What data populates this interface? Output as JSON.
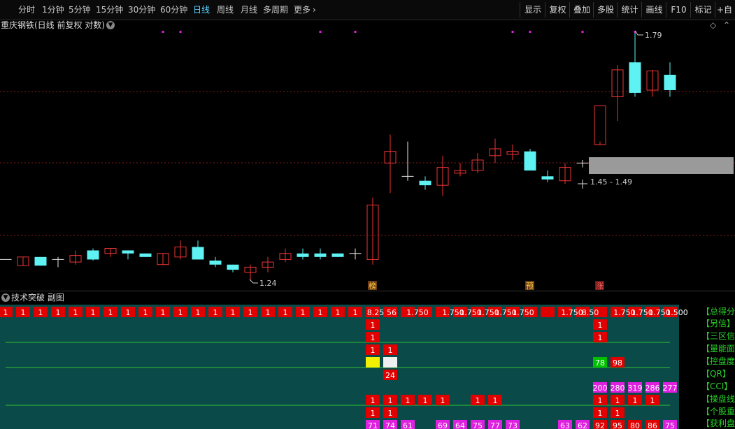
{
  "toolbar": {
    "periods": [
      "分时",
      "1分钟",
      "5分钟",
      "15分钟",
      "30分钟",
      "60分钟",
      "日线",
      "周线",
      "月线",
      "多周期",
      "更多"
    ],
    "active_period": "日线",
    "buttons": [
      "显示",
      "复权",
      "叠加",
      "多股",
      "统计",
      "画线",
      "F10",
      "标记",
      "+自选"
    ]
  },
  "chart": {
    "title": "重庆钢铁(日线 前复权 对数)",
    "annotation_high": "1.79",
    "annotation_low": "1.24",
    "annotation_range": "1.45 - 1.49",
    "markers": [
      "榜",
      "预",
      "涨"
    ],
    "scale": "log",
    "candles": [
      {
        "o": 1.25,
        "h": 1.25,
        "l": 1.25,
        "c": 1.25
      },
      {
        "o": 1.238,
        "h": 1.255,
        "l": 1.238,
        "c": 1.255
      },
      {
        "o": 1.255,
        "h": 1.255,
        "l": 1.238,
        "c": 1.238
      },
      {
        "o": 1.25,
        "h": 1.255,
        "l": 1.235,
        "c": 1.25
      },
      {
        "o": 1.245,
        "h": 1.268,
        "l": 1.24,
        "c": 1.258
      },
      {
        "o": 1.268,
        "h": 1.272,
        "l": 1.248,
        "c": 1.25
      },
      {
        "o": 1.262,
        "h": 1.272,
        "l": 1.255,
        "c": 1.272
      },
      {
        "o": 1.268,
        "h": 1.268,
        "l": 1.25,
        "c": 1.262
      },
      {
        "o": 1.262,
        "h": 1.262,
        "l": 1.255,
        "c": 1.255
      },
      {
        "o": 1.24,
        "h": 1.262,
        "l": 1.24,
        "c": 1.262
      },
      {
        "o": 1.255,
        "h": 1.288,
        "l": 1.25,
        "c": 1.275
      },
      {
        "o": 1.275,
        "h": 1.288,
        "l": 1.25,
        "c": 1.25
      },
      {
        "o": 1.248,
        "h": 1.255,
        "l": 1.235,
        "c": 1.24
      },
      {
        "o": 1.24,
        "h": 1.24,
        "l": 1.225,
        "c": 1.23
      },
      {
        "o": 1.225,
        "h": 1.24,
        "l": 1.21,
        "c": 1.235
      },
      {
        "o": 1.235,
        "h": 1.255,
        "l": 1.225,
        "c": 1.245
      },
      {
        "o": 1.25,
        "h": 1.272,
        "l": 1.245,
        "c": 1.262
      },
      {
        "o": 1.262,
        "h": 1.272,
        "l": 1.25,
        "c": 1.255
      },
      {
        "o": 1.262,
        "h": 1.272,
        "l": 1.25,
        "c": 1.255
      },
      {
        "o": 1.262,
        "h": 1.262,
        "l": 1.255,
        "c": 1.255
      },
      {
        "o": 1.262,
        "h": 1.272,
        "l": 1.25,
        "c": 1.262
      },
      {
        "o": 1.25,
        "h": 1.378,
        "l": 1.24,
        "c": 1.362
      },
      {
        "o": 1.455,
        "h": 1.522,
        "l": 1.388,
        "c": 1.482
      },
      {
        "o": 1.425,
        "h": 1.505,
        "l": 1.415,
        "c": 1.425
      },
      {
        "o": 1.415,
        "h": 1.425,
        "l": 1.395,
        "c": 1.405
      },
      {
        "o": 1.405,
        "h": 1.472,
        "l": 1.382,
        "c": 1.445
      },
      {
        "o": 1.432,
        "h": 1.455,
        "l": 1.425,
        "c": 1.438
      },
      {
        "o": 1.438,
        "h": 1.478,
        "l": 1.432,
        "c": 1.462
      },
      {
        "o": 1.472,
        "h": 1.512,
        "l": 1.455,
        "c": 1.488
      },
      {
        "o": 1.475,
        "h": 1.498,
        "l": 1.462,
        "c": 1.482
      },
      {
        "o": 1.482,
        "h": 1.488,
        "l": 1.438,
        "c": 1.438
      },
      {
        "o": 1.425,
        "h": 1.438,
        "l": 1.412,
        "c": 1.418
      },
      {
        "o": 1.415,
        "h": 1.455,
        "l": 1.408,
        "c": 1.445
      },
      {
        "o": 1.455,
        "h": 1.462,
        "l": 1.445,
        "c": 1.455
      },
      {
        "o": 1.498,
        "h": 1.505,
        "l": 1.498,
        "c": 1.592
      },
      {
        "o": 1.615,
        "h": 1.698,
        "l": 1.555,
        "c": 1.685
      },
      {
        "o": 1.705,
        "h": 1.79,
        "l": 1.615,
        "c": 1.625
      },
      {
        "o": 1.632,
        "h": 1.685,
        "l": 1.615,
        "c": 1.682
      },
      {
        "o": 1.672,
        "h": 1.705,
        "l": 1.615,
        "c": 1.632
      }
    ],
    "magenta_dot_indices": [
      9,
      10,
      18,
      20,
      29,
      30,
      33,
      36
    ]
  },
  "subpanel": {
    "title": "技术突破 副图",
    "row1_number_labels": [
      "8.25",
      "56",
      "1.750",
      "1.750",
      "1.750",
      "1.750",
      "1.750",
      "1.750",
      "1.750",
      "8.50",
      "1.750",
      "1.750",
      "1.750",
      "1.500"
    ],
    "values": {
      "r2": [
        "1",
        "1"
      ],
      "r3": [
        "1",
        "1"
      ],
      "r4": [
        "1",
        "1"
      ],
      "r5": [
        "78",
        "98"
      ],
      "r6": [
        "24"
      ],
      "r7": [
        "200",
        "280",
        "319",
        "286",
        "277"
      ],
      "r8": [
        "1",
        "1",
        "1",
        "1",
        "1",
        "1",
        "1",
        "1",
        "1",
        "1",
        "1"
      ],
      "r9": [
        "1",
        "1",
        "1",
        "1"
      ],
      "r10": [
        "71",
        "74",
        "61",
        "69",
        "64",
        "75",
        "77",
        "73",
        "63",
        "62",
        "92",
        "95",
        "80",
        "86",
        "75"
      ]
    },
    "side_labels": [
      "【总得分",
      "【另信】",
      "【三区信",
      "【量能面",
      "【控盘度",
      "【QR】",
      "【CCI】",
      "【操盘线",
      "【个股重",
      "【获利盘"
    ],
    "colors": {
      "panel_bg": "#0a4a48",
      "red": "#e00000",
      "magenta": "#e020e0",
      "yellow": "#f0f000",
      "green_cell": "#00c000",
      "line_green": "#30c030",
      "side_label": "#28d028"
    }
  }
}
